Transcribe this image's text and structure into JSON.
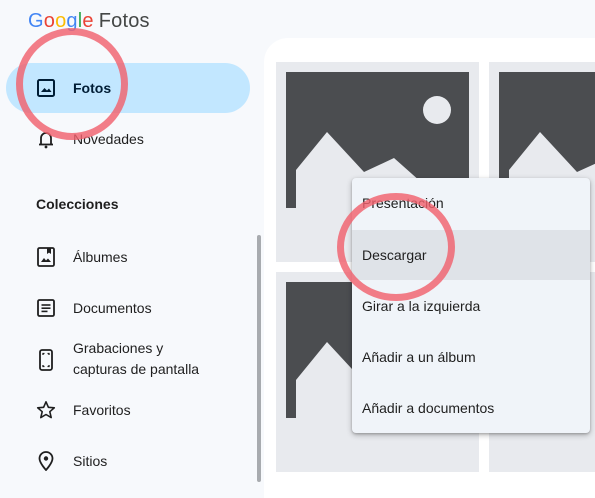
{
  "app": {
    "logo_letters": [
      "G",
      "o",
      "o",
      "g",
      "l",
      "e"
    ],
    "product_name": "Fotos",
    "brand_colors": [
      "#4285f4",
      "#ea4335",
      "#fbbc05",
      "#4285f4",
      "#34a853",
      "#ea4335"
    ]
  },
  "sidebar": {
    "items": [
      {
        "label": "Fotos",
        "icon": "photo-icon",
        "active": true
      },
      {
        "label": "Novedades",
        "icon": "bell-icon",
        "active": false
      }
    ],
    "collections_title": "Colecciones",
    "collections": [
      {
        "label": "Álbumes",
        "icon": "album-icon"
      },
      {
        "label": "Documentos",
        "icon": "document-icon"
      },
      {
        "label": "Grabaciones y",
        "label_line2": "capturas de pantalla",
        "icon": "phone-screenshot-icon"
      },
      {
        "label": "Favoritos",
        "icon": "star-icon"
      },
      {
        "label": "Sitios",
        "icon": "location-pin-icon"
      }
    ]
  },
  "context_menu": {
    "items": [
      {
        "label": "Presentación",
        "highlighted": false
      },
      {
        "label": "Descargar",
        "highlighted": true
      },
      {
        "label": "Girar a la izquierda",
        "highlighted": false
      },
      {
        "label": "Añadir a un álbum",
        "highlighted": false
      },
      {
        "label": "Añadir a documentos",
        "highlighted": false
      }
    ]
  },
  "colors": {
    "active_nav": "#c2e7ff",
    "highlight_circle": "#f0626e",
    "menu_background": "#f0f4f9",
    "placeholder": "#4b4d50"
  }
}
